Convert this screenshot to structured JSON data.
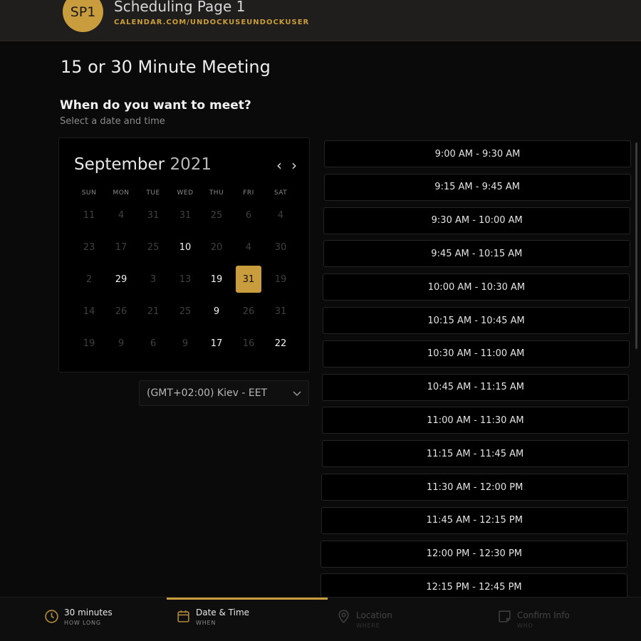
{
  "header": {
    "avatar_initials": "SP1",
    "title": "Scheduling Page 1",
    "url": "CALENDAR.COM/UNDOCKUSEUNDOCKUSER"
  },
  "page": {
    "meeting_title": "15 or 30 Minute Meeting",
    "question": "When do you want to meet?",
    "hint": "Select a date and time"
  },
  "calendar": {
    "month": "September",
    "year": "2021",
    "prev_glyph": "‹",
    "next_glyph": "›",
    "weekdays": [
      "SUN",
      "MON",
      "TUE",
      "WED",
      "THU",
      "FRI",
      "SAT"
    ],
    "weeks": [
      [
        {
          "d": "11",
          "s": "dim"
        },
        {
          "d": "4",
          "s": "dim"
        },
        {
          "d": "31",
          "s": "dim"
        },
        {
          "d": "31",
          "s": "dim"
        },
        {
          "d": "25",
          "s": "dim"
        },
        {
          "d": "6",
          "s": "dim"
        },
        {
          "d": "4",
          "s": "dim"
        }
      ],
      [
        {
          "d": "23",
          "s": "dim"
        },
        {
          "d": "17",
          "s": "dim"
        },
        {
          "d": "25",
          "s": "dim"
        },
        {
          "d": "10",
          "s": "active"
        },
        {
          "d": "20",
          "s": "dim"
        },
        {
          "d": "4",
          "s": "dim"
        },
        {
          "d": "30",
          "s": "dim"
        }
      ],
      [
        {
          "d": "2",
          "s": "dim"
        },
        {
          "d": "29",
          "s": "active"
        },
        {
          "d": "3",
          "s": "dim"
        },
        {
          "d": "13",
          "s": "dim"
        },
        {
          "d": "19",
          "s": "active"
        },
        {
          "d": "31",
          "s": "selected"
        },
        {
          "d": "19",
          "s": "dim"
        }
      ],
      [
        {
          "d": "14",
          "s": "dim"
        },
        {
          "d": "26",
          "s": "dim"
        },
        {
          "d": "21",
          "s": "dim"
        },
        {
          "d": "25",
          "s": "dim"
        },
        {
          "d": "9",
          "s": "active"
        },
        {
          "d": "26",
          "s": "dim"
        },
        {
          "d": "31",
          "s": "dim"
        }
      ],
      [
        {
          "d": "19",
          "s": "dim"
        },
        {
          "d": "9",
          "s": "dim"
        },
        {
          "d": "6",
          "s": "dim"
        },
        {
          "d": "9",
          "s": "dim"
        },
        {
          "d": "17",
          "s": "active"
        },
        {
          "d": "16",
          "s": "dim"
        },
        {
          "d": "22",
          "s": "active"
        }
      ]
    ]
  },
  "timezone": {
    "label": "(GMT+02:00) Kiev - EET"
  },
  "time_slots": [
    "9:00 AM - 9:30 AM",
    "9:15 AM - 9:45 AM",
    "9:30 AM - 10:00 AM",
    "9:45 AM - 10:15 AM",
    "10:00 AM - 10:30 AM",
    "10:15 AM - 10:45 AM",
    "10:30 AM - 11:00 AM",
    "10:45 AM - 11:15 AM",
    "11:00 AM - 11:30 AM",
    "11:15 AM - 11:45 AM",
    "11:30 AM - 12:00 PM",
    "11:45 AM - 12:15 PM",
    "12:00 PM - 12:30 PM",
    "12:15 PM - 12:45 PM"
  ],
  "steps": [
    {
      "label": "30 minutes",
      "sub": "HOW LONG",
      "icon": "clock-icon",
      "state": "on"
    },
    {
      "label": "Date & Time",
      "sub": "WHEN",
      "icon": "calendar-icon",
      "state": "on"
    },
    {
      "label": "Location",
      "sub": "WHERE",
      "icon": "location-pin-icon",
      "state": "off"
    },
    {
      "label": "Confirm Info",
      "sub": "WHO",
      "icon": "note-icon",
      "state": "off"
    }
  ],
  "colors": {
    "accent": "#c99d3d",
    "background": "#0a0a0a",
    "header_bg": "#1f1e1c"
  }
}
